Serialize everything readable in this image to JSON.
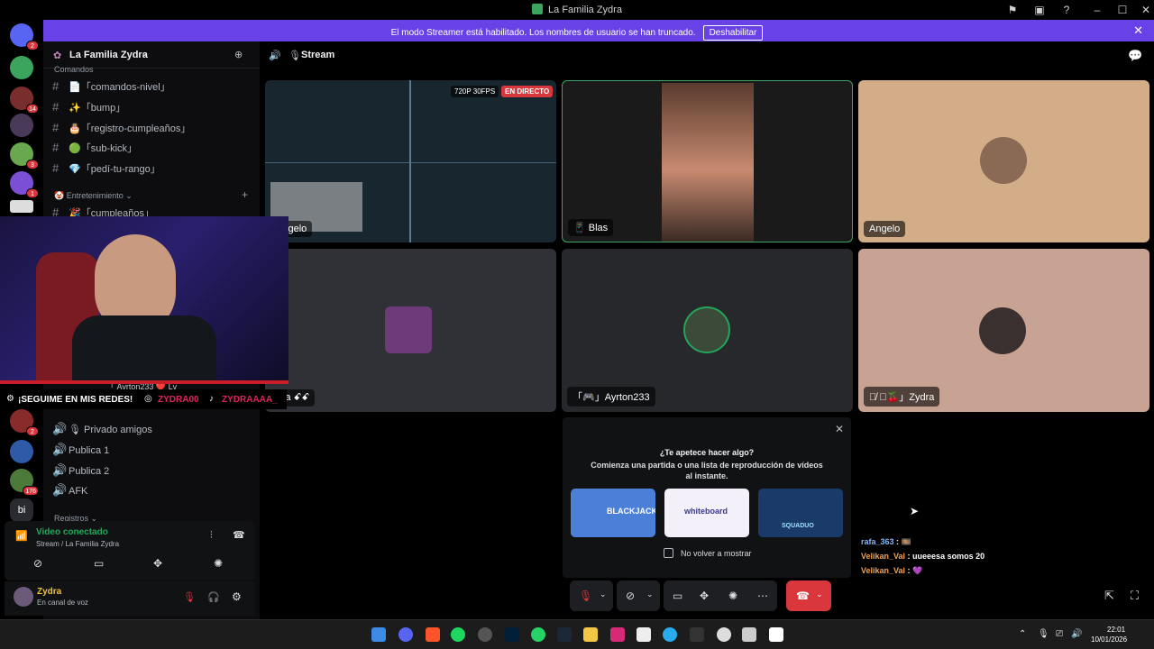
{
  "window": {
    "title": "La Familia Zydra"
  },
  "banner": {
    "message": "El modo Streamer está habilitado. Los nombres de usuario se han truncado.",
    "button": "Deshabilitar"
  },
  "rail": {
    "servers": [
      {
        "badge": "2",
        "color": "#5865f2"
      },
      {
        "badge": "",
        "color": "#3ba55d"
      },
      {
        "badge": "14",
        "color": "#7a2d2d"
      },
      {
        "badge": "",
        "color": "#4a3a5a"
      },
      {
        "badge": "3",
        "color": "#6aa84f"
      },
      {
        "badge": "1",
        "color": "#7b4fd6"
      },
      {
        "badge": "",
        "color": "#dddddd"
      }
    ],
    "lower_servers": [
      {
        "badge": "2",
        "color": "#8a2b2b"
      },
      {
        "badge": "",
        "color": "#2e5aa8"
      },
      {
        "badge": "176",
        "color": "#4c7a3a"
      },
      {
        "badge": "",
        "color": "#2a2b30",
        "text": "bi"
      }
    ]
  },
  "sidebar": {
    "server_name": "La Familia Zydra",
    "top_category": "Comandos",
    "channels": [
      "📄「comandos-nivel」",
      "✨「bump」",
      "🎂「registro-cumpleaños」",
      "🟢「sub-kick」",
      "💎「pedí-tu-rango」"
    ],
    "category_entretenimiento": "Entretenimiento",
    "channel_cumple": "🎉「cumpleaños」",
    "voice_channels": [
      "🎙 Privado amigos",
      "Publica 1",
      "Publica 2",
      "AFK"
    ],
    "category_registros": "Registros",
    "hidden_member": "「 Ayrton233 ❤️ Lv"
  },
  "voice_panel": {
    "status": "Video conectado",
    "location": "Stream / La Familia Zydra"
  },
  "user_panel": {
    "name": "Zydra",
    "status": "En canal de voz"
  },
  "stage": {
    "channel": "Stream",
    "tiles": [
      {
        "name": "Angelo",
        "badges": [
          "720P 30FPS",
          "EN DIRECTO"
        ]
      },
      {
        "name": "Blas"
      },
      {
        "name": "Angelo"
      },
      {
        "name": "lisa ꗃꗃ"
      },
      {
        "name": "「🎮」Ayrton233"
      },
      {
        "name": "「🍒」Zydra"
      }
    ]
  },
  "socials": {
    "cta": "¡SEGUIME EN MIS REDES!",
    "instagram": "ZYDRA00",
    "tiktok": "ZYDRAAAA_"
  },
  "activity": {
    "title": "¿Te apetece hacer algo?",
    "subtitle": "Comienza una partida o una lista de reproducción de vídeos al instante.",
    "cards": [
      "BLACKJACK",
      "whiteboard",
      "SQUADUO"
    ],
    "checkbox_label": "No volver a mostrar"
  },
  "chat": [
    {
      "user": "rafa_363",
      "text": "🎞️",
      "color": "#8ab4f8"
    },
    {
      "user": "Velikan_Val",
      "text": "uueeesa somos 20",
      "color": "#f0a050"
    },
    {
      "user": "Velikan_Val",
      "text": "💜",
      "color": "#f0a050"
    }
  ],
  "taskbar": {
    "time": "22:01",
    "date": "10/01/2026"
  }
}
